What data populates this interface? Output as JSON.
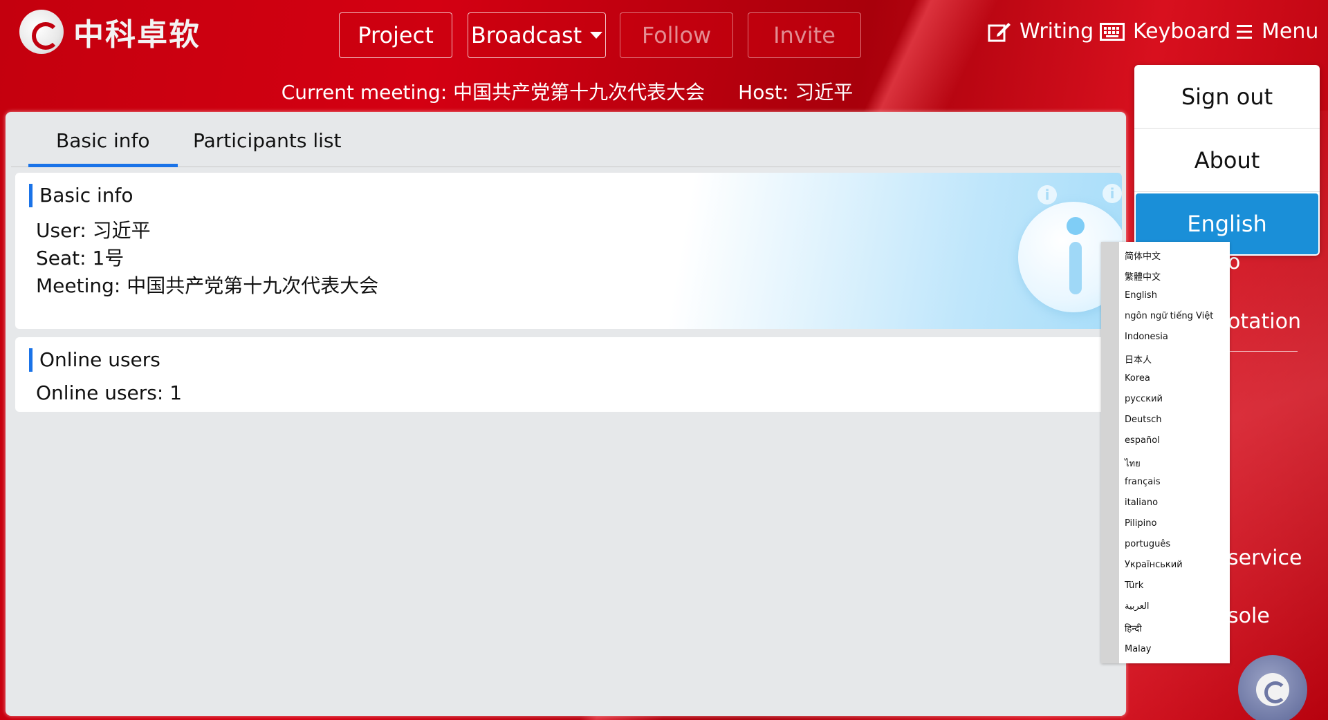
{
  "app": {
    "brand": "中科卓软"
  },
  "nav": {
    "project": "Project",
    "broadcast": "Broadcast",
    "follow": "Follow",
    "invite": "Invite"
  },
  "tools": {
    "writing": "Writing",
    "keyboard": "Keyboard",
    "menu": "Menu"
  },
  "meeting": {
    "current": "Current meeting: 中国共产党第十九次代表大会",
    "host": "Host: 习近平"
  },
  "tabs": [
    {
      "label": "Basic info"
    },
    {
      "label": "Participants list"
    }
  ],
  "basic": {
    "title": "Basic info",
    "user": "User: 习近平",
    "seat": "Seat: 1号",
    "meeting": "Meeting: 中国共产党第十九次代表大会"
  },
  "online": {
    "title": "Online users",
    "count": "Online users: 1"
  },
  "menu": {
    "items": [
      {
        "label": "Sign out"
      },
      {
        "label": "About"
      },
      {
        "label": "English"
      }
    ],
    "partial": {
      "t1": "o",
      "t2": "otation",
      "t3": "service",
      "t4": "sole"
    }
  },
  "languages": [
    "简体中文",
    "繁體中文",
    "English",
    "ngôn ngữ tiếng Việt",
    "Indonesia",
    "日本人",
    "Korea",
    "русский",
    "Deutsch",
    "español",
    "ไทย",
    "français",
    "italiano",
    "Pilipino",
    "português",
    "Український",
    "Türk",
    "العربية",
    "हिन्दी",
    "Malay"
  ],
  "colors": {
    "accent": "#1a73e8",
    "brand_red": "#c4000e",
    "selected": "#1a8fd8"
  }
}
